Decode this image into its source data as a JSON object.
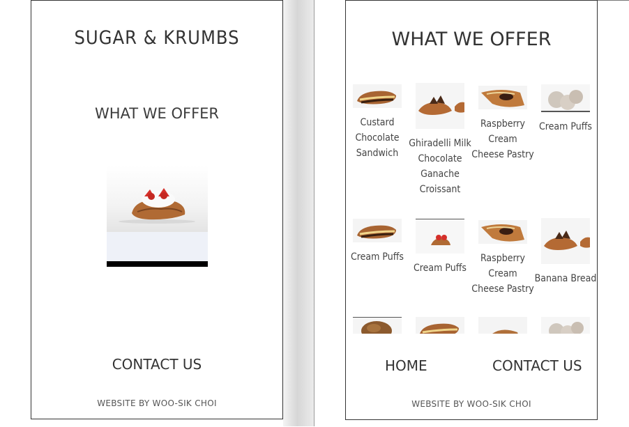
{
  "left_screen": {
    "brand": "SUGAR & KRUMBS",
    "section_link": "WHAT WE OFFER",
    "contact_link": "CONTACT US",
    "credit": "WEBSITE BY WOO-SIK CHOI"
  },
  "right_screen": {
    "title": "WHAT WE OFFER",
    "products": [
      {
        "name": "Custard Chocolate Sandwich",
        "image": "custard-sandwich"
      },
      {
        "name": "Ghiradelli Milk Chocolate Ganache Croissant",
        "image": "croissant"
      },
      {
        "name": "Raspberry Cream Cheese Pastry",
        "image": "danish"
      },
      {
        "name": "Cream Puffs",
        "image": "cream-puffs"
      },
      {
        "name": "Cream Puffs",
        "image": "custard-sandwich"
      },
      {
        "name": "Cream Puffs",
        "image": "berry-croissant"
      },
      {
        "name": "Raspberry Cream Cheese Pastry",
        "image": "danish"
      },
      {
        "name": "Banana Bread",
        "image": "croissant"
      },
      {
        "name": "",
        "image": "muffin"
      },
      {
        "name": "",
        "image": "custard-sandwich"
      },
      {
        "name": "",
        "image": "danish"
      },
      {
        "name": "",
        "image": "cream-puffs"
      }
    ],
    "nav_home": "HOME",
    "nav_contact": "CONTACT US",
    "credit": "WEBSITE BY WOO-SIK CHOI"
  },
  "colors": {
    "text": "#333333",
    "background": "#ffffff",
    "pastry": "#b0703a",
    "chocolate": "#4a2a18",
    "strawberry": "#d5302a"
  }
}
